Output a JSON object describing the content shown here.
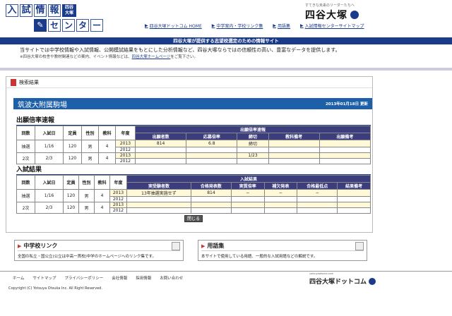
{
  "header": {
    "logo_row1": [
      "入",
      "試",
      "情",
      "報"
    ],
    "logo_badge": "四谷\n大塚",
    "logo_row2": [
      "セ",
      "ン",
      "タ",
      "ー"
    ],
    "brand_tagline": "すてきな未来のリーダーたちへ",
    "brand_name": "四谷大塚",
    "nav": [
      {
        "label": "四谷大塚ドットコム HOME"
      },
      {
        "label": "中学案内・学校リンク集"
      },
      {
        "label": "用語集"
      },
      {
        "label": "入試情報センターサイトマップ"
      }
    ]
  },
  "banner": "四谷大塚が提供する志望校選定のための情報サイト",
  "intro": {
    "text": "当サイトでは中学校情報や入試情報、公開模試結果をもとにした分析情報など、四谷大塚ならではの信頼性の高い、豊富なデータを提供します。",
    "note_prefix": "※四谷大塚の校舎や教材関連などの案内、イベント情報などは、",
    "note_link": "四谷大塚ホームページ",
    "note_suffix": "をご覧下さい。"
  },
  "result": {
    "title": "検索結果",
    "school_name": "筑波大附属駒場",
    "date": "2013年01月18日 更新",
    "sec1_heading": "出願倍率速報",
    "sec1_headers": [
      "回数",
      "入試日",
      "定員",
      "性別",
      "教科",
      "年度"
    ],
    "sec1_group": "出願倍率速報",
    "sec1_sub": [
      "出願者数",
      "応募倍率",
      "締切",
      "教科備考",
      "出願備考"
    ],
    "sec1_rows": [
      {
        "round": "抽選",
        "date": "1/16",
        "cap": "120",
        "sex": "男",
        "subj": "4",
        "years": [
          "2013",
          "2012"
        ],
        "apps": [
          "814",
          ""
        ],
        "ratio": [
          "6.8",
          ""
        ],
        "deadline": [
          "締切",
          ""
        ],
        "subj_note": [
          "",
          ""
        ],
        "app_note": [
          "",
          ""
        ]
      },
      {
        "round": "2次",
        "date": "2/3",
        "cap": "120",
        "sex": "男",
        "subj": "4",
        "years": [
          "2013",
          "2012"
        ],
        "apps": [
          "",
          ""
        ],
        "ratio": [
          "",
          ""
        ],
        "deadline": [
          "1/23",
          ""
        ],
        "subj_note": [
          "",
          ""
        ],
        "app_note": [
          "",
          ""
        ]
      }
    ],
    "sec2_heading": "入試結果",
    "sec2_headers": [
      "回数",
      "入試日",
      "定員",
      "性別",
      "教科",
      "年度"
    ],
    "sec2_group": "入試結果",
    "sec2_sub": [
      "実受験者数",
      "合格発表数",
      "実質倍率",
      "補欠発表",
      "合格最低点",
      "結果備考"
    ],
    "sec2_rows": [
      {
        "round": "抽選",
        "date": "1/16",
        "cap": "120",
        "sex": "男",
        "subj": "4",
        "years": [
          "2013",
          "2012"
        ],
        "exam": [
          "13年抽選実施せず",
          ""
        ],
        "pass": [
          "814",
          ""
        ],
        "ratio": [
          "−",
          ""
        ],
        "waitlist": [
          "−",
          ""
        ],
        "min": [
          "−",
          ""
        ],
        "note": [
          "",
          ""
        ]
      },
      {
        "round": "2次",
        "date": "2/3",
        "cap": "120",
        "sex": "男",
        "subj": "4",
        "years": [
          "2013",
          "2012"
        ],
        "exam": [
          "",
          ""
        ],
        "pass": [
          "",
          ""
        ],
        "ratio": [
          "",
          ""
        ],
        "waitlist": [
          "",
          ""
        ],
        "min": [
          "",
          ""
        ],
        "note": [
          "",
          ""
        ]
      }
    ],
    "close_label": "閉じる"
  },
  "panels": [
    {
      "title": "中学校リンク",
      "body": "全国の私立・国公立(公立は中高一貫校)中学のホームページへのリンク集です。"
    },
    {
      "title": "用語集",
      "body": "本サイトで使用している用語、一般的な入試用語などの解説です。"
    }
  ],
  "footer": {
    "nav": [
      "ホーム",
      "サイトマップ",
      "プライバシーポリシー",
      "会社情報",
      "採用情報",
      "お問い合わせ"
    ],
    "copyright": "Copyright (C) Yotsuya Otsuka Inc. All Right Reserved.",
    "brand": "四谷大塚ドットコム",
    "brand_tag": "yotsuyaotsuka.com"
  },
  "colors": {
    "primary": "#1a3a8a",
    "table_header": "#3c3d7d",
    "school_bar": "#1d5fa8",
    "cell_highlight": "#fff9d8"
  }
}
